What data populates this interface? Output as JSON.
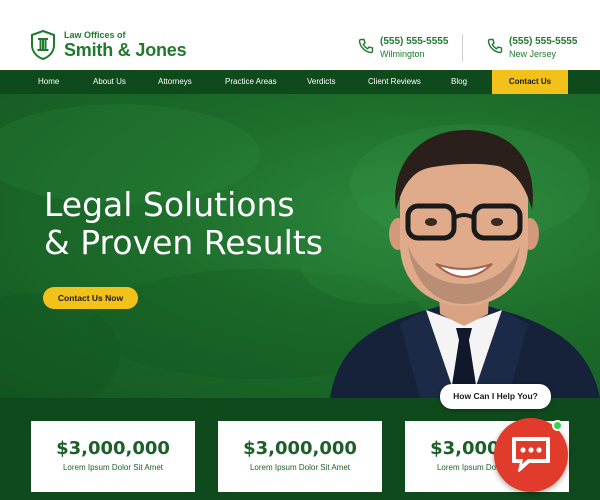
{
  "brand": {
    "small_line": "Law Offices of",
    "name": "Smith & Jones"
  },
  "contacts": [
    {
      "phone": "(555) 555-5555",
      "city": "Wilmington"
    },
    {
      "phone": "(555) 555-5555",
      "city": "New Jersey"
    }
  ],
  "nav": {
    "items": [
      "Home",
      "About Us",
      "Attorneys",
      "Practice Areas",
      "Verdicts",
      "Client Reviews",
      "Blog"
    ],
    "cta": "Contact Us"
  },
  "hero": {
    "title_line1": "Legal Solutions",
    "title_line2": "& Proven Results",
    "button": "Contact Us Now"
  },
  "stats": [
    {
      "value": "$3,000,000",
      "label": "Lorem Ipsum Dolor Sit Amet"
    },
    {
      "value": "$3,000,000",
      "label": "Lorem Ipsum Dolor Sit Amet"
    },
    {
      "value": "$3,000,000",
      "label": "Lorem Ipsum Dolor Sit Amet"
    }
  ],
  "chat": {
    "prompt": "How Can I Help You?",
    "icon": "chat-icon"
  },
  "colors": {
    "brand_green": "#1f7a2e",
    "nav_green": "#0f4a1c",
    "accent_yellow": "#f2c21b",
    "chat_red": "#e03b2b"
  }
}
